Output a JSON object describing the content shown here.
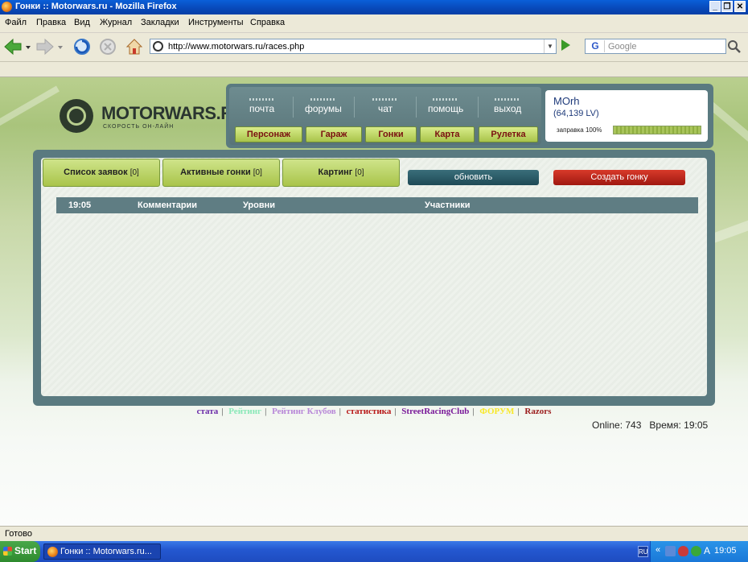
{
  "window": {
    "title": "Гонки :: Motorwars.ru - Mozilla Firefox"
  },
  "menu": [
    "Файл",
    "Правка",
    "Вид",
    "Журнал",
    "Закладки",
    "Инструменты",
    "Справка"
  ],
  "address": {
    "url": "http://www.motorwars.ru/races.php"
  },
  "search": {
    "placeholder": "Google",
    "engine_letter": "G"
  },
  "site": {
    "logo_name": "MOTORWARS.RU",
    "logo_slogan": "СКОРОСТЬ ОН-ЛАЙН",
    "top_links": [
      "почта",
      "форумы",
      "чат",
      "помощь",
      "выход"
    ],
    "nav_buttons": [
      "Персонаж",
      "Гараж",
      "Гонки",
      "Карта",
      "Рулетка"
    ],
    "user": {
      "name": "MOrh",
      "level": "(64,139 LV)",
      "fuel_label": "заправка 100%",
      "fuel_fraction": 1.0
    },
    "tabs": [
      {
        "label": "Список заявок",
        "count": "[0]"
      },
      {
        "label": "Активные гонки",
        "count": "[0]"
      },
      {
        "label": "Картинг",
        "count": "[0]"
      }
    ],
    "refresh_label": "обновить",
    "create_label": "Создать гонку",
    "table_headers": [
      "19:05",
      "Комментарии",
      "Уровни",
      "Участники"
    ],
    "footer_links": [
      {
        "text": "стата",
        "color": "#6a2aa8"
      },
      {
        "text": "Рейтинг",
        "color": "#8ae8b8"
      },
      {
        "text": "Рейтинг Клубов",
        "color": "#b888d8"
      },
      {
        "text": "статистика",
        "color": "#b81818"
      },
      {
        "text": "StreetRacingClub",
        "color": "#7a1a9a"
      },
      {
        "text": "ФОРУМ",
        "color": "#f8e828"
      },
      {
        "text": "Razors",
        "color": "#9a1a1a"
      }
    ],
    "online_text": "Online: 743",
    "time_text": "Время: 19:05"
  },
  "status": "Готово",
  "taskbar": {
    "start_label": "Start",
    "task_label": "Гонки :: Motorwars.ru...",
    "lang": "RU",
    "clock": "19:05"
  }
}
